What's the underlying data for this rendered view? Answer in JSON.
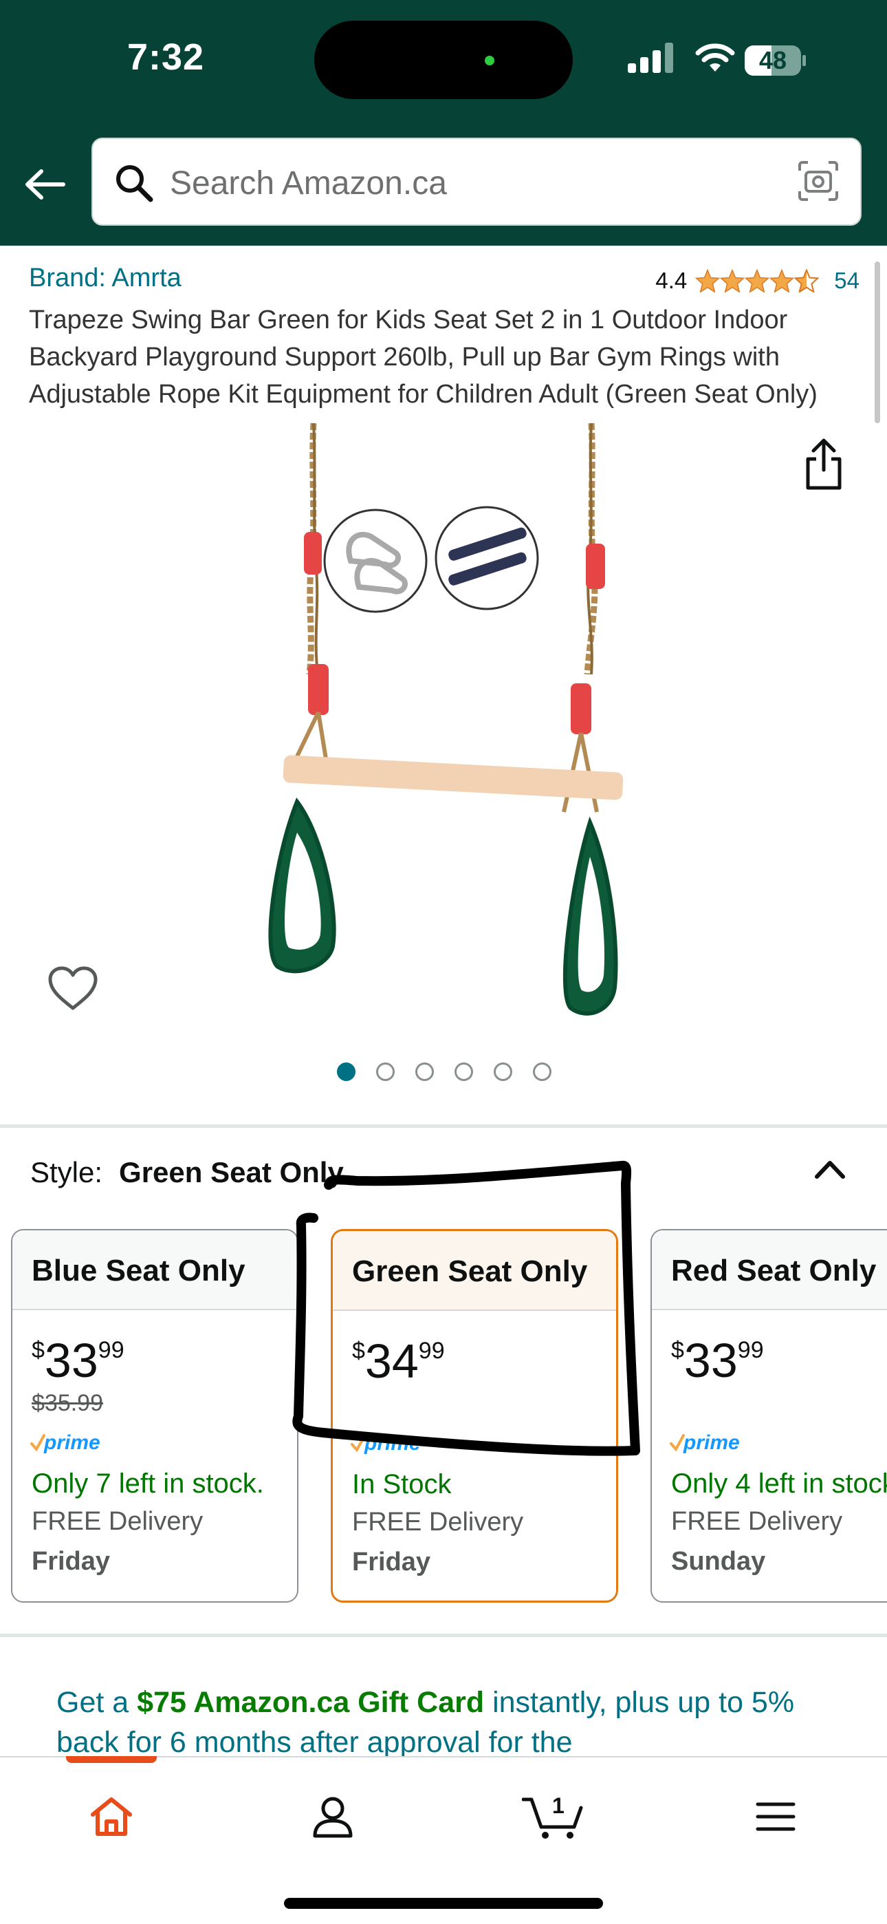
{
  "status_bar": {
    "time": "7:32",
    "battery": "48",
    "battery_level": 0.48
  },
  "search": {
    "placeholder": "Search Amazon.ca"
  },
  "product": {
    "brand": "Brand: Amrta",
    "rating": "4.4",
    "rating_value": 4.4,
    "review_count": "54",
    "title": "Trapeze Swing Bar Green for Kids Seat Set 2 in 1 Outdoor Indoor Backyard Playground Support 260lb, Pull up Bar Gym Rings with Adjustable Rope Kit Equipment for Children Adult (Green Seat Only)",
    "image_count": 6,
    "current_image": 1
  },
  "style": {
    "label": "Style:",
    "selected": "Green Seat Only",
    "options": [
      {
        "name": "Blue Seat Only",
        "currency": "$",
        "whole": "33",
        "fraction": "99",
        "was": "$35.99",
        "prime": true,
        "stock": "Only 7 left in stock.",
        "delivery": "FREE Delivery",
        "day": "Friday"
      },
      {
        "name": "Green Seat Only",
        "currency": "$",
        "whole": "34",
        "fraction": "99",
        "was": "",
        "prime": true,
        "stock": "In Stock",
        "delivery": "FREE Delivery",
        "day": "Friday"
      },
      {
        "name": "Red Seat Only",
        "currency": "$",
        "whole": "33",
        "fraction": "99",
        "was": "",
        "prime": true,
        "stock": "Only 4 left in stock.",
        "delivery": "FREE Delivery",
        "day": "Sunday"
      }
    ]
  },
  "promo": {
    "prefix": "Get a ",
    "highlight": "$75 Amazon.ca Gift Card",
    "suffix": " instantly, plus up to 5% back for 6 months after approval for the"
  },
  "bottom_nav": {
    "items": [
      "home-icon",
      "account-icon",
      "cart-icon",
      "menu-icon"
    ],
    "cart_count": "1"
  },
  "colors": {
    "header": "#064236",
    "link": "#007185",
    "selected_border": "#e47911",
    "in_stock": "#007600",
    "star": "#f3a847",
    "active_nav": "#e74c1a"
  }
}
